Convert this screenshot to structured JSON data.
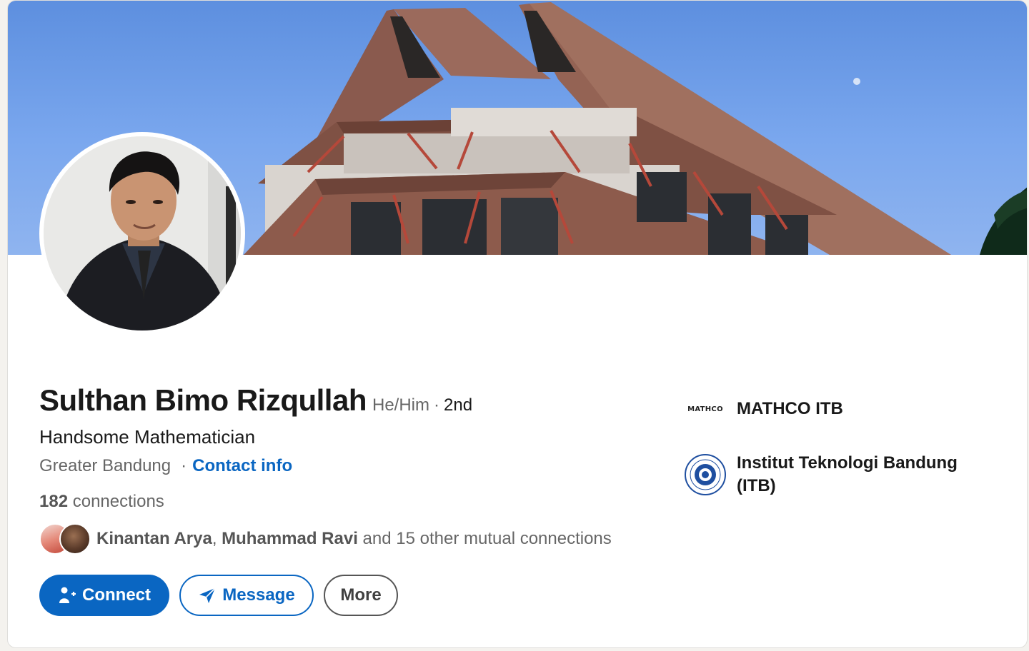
{
  "profile": {
    "name": "Sulthan Bimo Rizqullah",
    "pronouns": "He/Him",
    "degree_separator": "·",
    "degree": "2nd",
    "headline": "Handsome Mathematician",
    "location": "Greater Bandung",
    "location_separator": "·",
    "contact_info_label": "Contact info",
    "connections_count": "182",
    "connections_label": "connections"
  },
  "mutual": {
    "name_1": "Kinantan Arya",
    "separator": ", ",
    "name_2": "Muhammad Ravi",
    "suffix": " and 15 other mutual connections"
  },
  "actions": {
    "connect_label": "Connect",
    "message_label": "Message",
    "more_label": "More"
  },
  "organizations": [
    {
      "logo_text": "MATHCO",
      "name": "MATHCO ITB",
      "icon": "mathco-logo"
    },
    {
      "name": "Institut Teknologi Bandung (ITB)",
      "icon": "itb-seal"
    }
  ],
  "colors": {
    "accent": "#0a66c2",
    "page_background": "#f4f2ee",
    "card_background": "#ffffff",
    "secondary_text": "#666666"
  }
}
